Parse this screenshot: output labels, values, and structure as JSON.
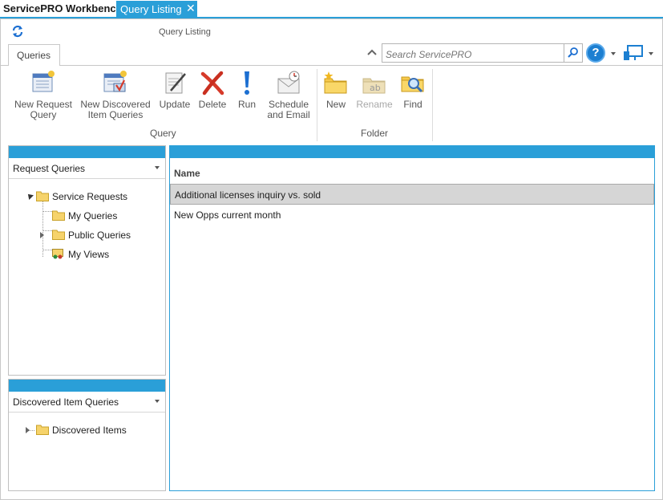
{
  "tabs": {
    "app_title": "ServicePRO Workbench",
    "active_tab": "Query Listing",
    "close_glyph": "✕"
  },
  "window": {
    "title": "Query Listing",
    "refresh_icon": "refresh-icon"
  },
  "ribbon": {
    "tab_label": "Queries",
    "search_placeholder": "Search ServicePRO",
    "help_glyph": "?",
    "groups": {
      "query": {
        "label": "Query",
        "buttons": {
          "new_request_query": "New Request\nQuery",
          "new_discovered_item_queries": "New Discovered\nItem Queries",
          "update": "Update",
          "delete": "Delete",
          "run": "Run",
          "schedule_and_email": "Schedule\nand Email"
        }
      },
      "folder": {
        "label": "Folder",
        "buttons": {
          "new": "New",
          "rename": "Rename",
          "find": "Find"
        }
      }
    }
  },
  "left_top": {
    "selector": "Request Queries",
    "tree": {
      "root": "Service Requests",
      "children": [
        "My Queries",
        "Public Queries",
        "My Views"
      ]
    }
  },
  "left_bottom": {
    "selector": "Discovered Item Queries",
    "tree": {
      "root": "Discovered Items"
    }
  },
  "grid": {
    "column_header": "Name",
    "rows": [
      {
        "name": "Additional licenses inquiry vs. sold",
        "selected": true
      },
      {
        "name": "New Opps current month",
        "selected": false
      }
    ]
  },
  "colors": {
    "accent": "#2a9fd8",
    "selection": "#d6d6d6",
    "help_button": "#1c7fd1",
    "delete_icon": "#d63a2a",
    "run_icon": "#1c6fd1"
  }
}
